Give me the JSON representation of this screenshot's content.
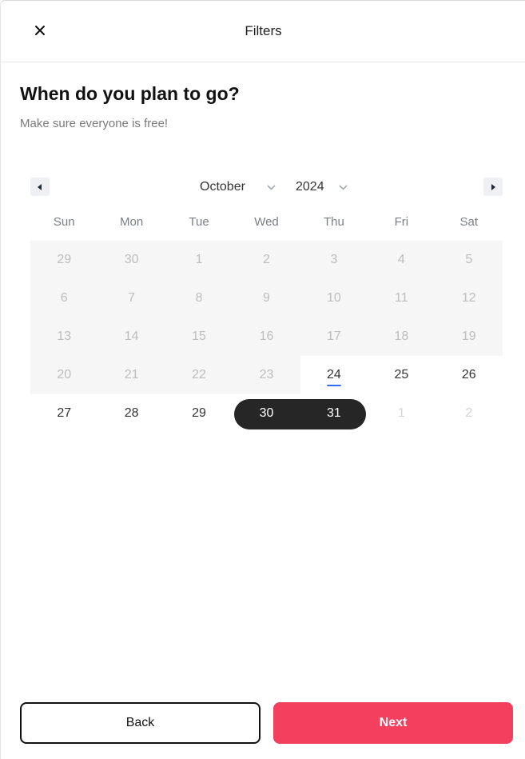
{
  "header": {
    "title": "Filters",
    "close_icon": "close-icon"
  },
  "question": "When do you plan to go?",
  "subtext": "Make sure everyone is free!",
  "calendar": {
    "month": "October",
    "year": "2024",
    "weekdays": [
      "Sun",
      "Mon",
      "Tue",
      "Wed",
      "Thu",
      "Fri",
      "Sat"
    ],
    "weeks": [
      [
        "29",
        "30",
        "1",
        "2",
        "3",
        "4",
        "5"
      ],
      [
        "6",
        "7",
        "8",
        "9",
        "10",
        "11",
        "12"
      ],
      [
        "13",
        "14",
        "15",
        "16",
        "17",
        "18",
        "19"
      ],
      [
        "20",
        "21",
        "22",
        "23",
        "24",
        "25",
        "26"
      ],
      [
        "27",
        "28",
        "29",
        "30",
        "31",
        "1",
        "2"
      ]
    ],
    "today": "24",
    "selected_range": [
      "30",
      "31"
    ]
  },
  "footer": {
    "back_label": "Back",
    "next_label": "Next"
  },
  "colors": {
    "accent": "#f43f5e",
    "selected": "#262626",
    "today_underline": "#2f6fed"
  }
}
